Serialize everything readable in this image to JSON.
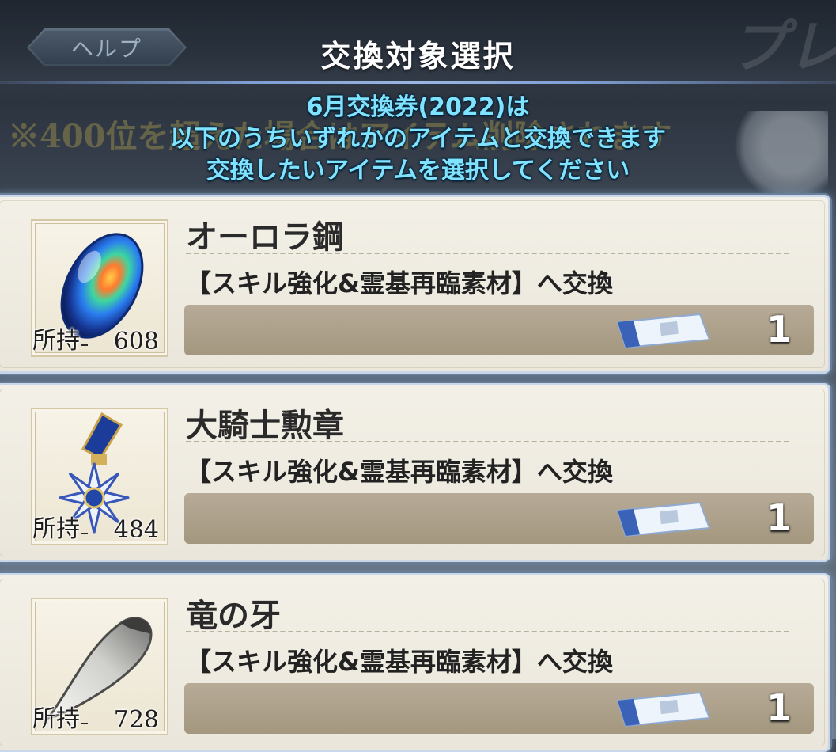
{
  "header": {
    "help_label": "ヘルプ",
    "title": "交換対象選択",
    "corner_text": "プレ"
  },
  "background": {
    "ghost_text": "※400位を超えた場合はアイテム削除されます"
  },
  "notice": {
    "line1": "6月交換券(2022)は",
    "line2": "以下のうちいずれかのアイテムと交換できます",
    "line3": "交換したいアイテムを選択してください"
  },
  "items": [
    {
      "name": "オーロラ鋼",
      "description": "【スキル強化&霊基再臨素材】へ交換",
      "owned_label": "所持",
      "owned_count": "608",
      "cost": "1",
      "icon": "aurora-steel-icon"
    },
    {
      "name": "大騎士勲章",
      "description": "【スキル強化&霊基再臨素材】へ交換",
      "owned_label": "所持",
      "owned_count": "484",
      "cost": "1",
      "icon": "great-knight-medal-icon"
    },
    {
      "name": "竜の牙",
      "description": "【スキル強化&霊基再臨素材】へ交換",
      "owned_label": "所持",
      "owned_count": "728",
      "cost": "1",
      "icon": "dragon-fang-icon"
    }
  ],
  "colors": {
    "notice_text": "#7fe3ff",
    "card_glow": "#c9d7ea",
    "cost_bar": "#ab9f88"
  }
}
